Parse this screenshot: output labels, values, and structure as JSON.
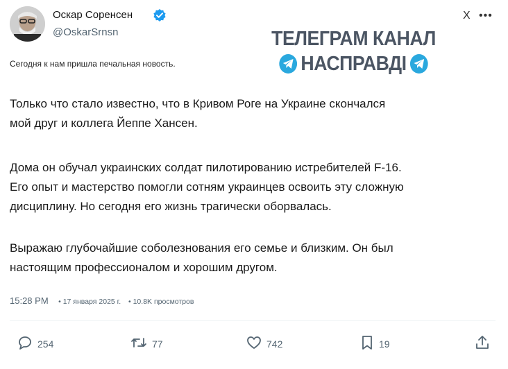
{
  "author": {
    "name": "Оскар Соренсен",
    "handle": "@OskarSrnsn"
  },
  "header_actions": {
    "close_label": "X",
    "more_label": "•••"
  },
  "watermark": {
    "line1": "ТЕЛЕГРАМ КАНАЛ",
    "line2": "НАСПРАВДІ"
  },
  "tweet": {
    "intro": "Сегодня к нам пришла печальная новость.",
    "p1": [
      "Только что стало известно, что в Кривом Роге на Украине скончался",
      "мой друг и коллега Йеппе Хансен."
    ],
    "p2": [
      "Дома он обучал украинских солдат пилотированию истребителей F-16.",
      "Его опыт и мастерство помогли сотням украинцев освоить эту сложную",
      "дисциплину. Но сегодня его жизнь трагически оборвалась."
    ],
    "p3": [
      "Выражаю глубочайшие соболезнования его семье и близким. Он был",
      "настоящим профессионалом и хорошим другом."
    ]
  },
  "meta": {
    "time": "15:28 PM",
    "date": "• 17 января 2025 г.",
    "views": "• 10.8K просмотров"
  },
  "actions": {
    "replies": "254",
    "reposts": "77",
    "likes": "742",
    "bookmarks": "19"
  },
  "colors": {
    "verified": "#1d9bf0",
    "telegram": "#2aa8de",
    "watermark": "#4b5563"
  }
}
